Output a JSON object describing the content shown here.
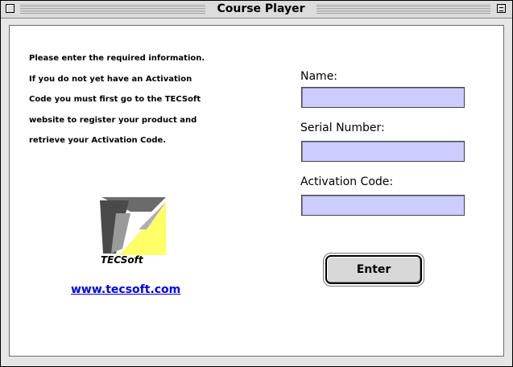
{
  "window": {
    "title": "Course Player"
  },
  "instructions": {
    "lines": [
      "Please enter the required information.",
      "If you do not yet have an Activation",
      "Code you must first go to the TECSoft",
      "website to register your product and",
      "retrieve your Activation Code."
    ]
  },
  "logo": {
    "text": "TECSoft",
    "icon": "tecsoft-logo-icon",
    "colors": {
      "dark": "#6b6b6b",
      "yellow": "#ffff66"
    }
  },
  "link": {
    "text": "www.tecsoft.com"
  },
  "form": {
    "name_label": "Name:",
    "name_value": "",
    "serial_label": "Serial Number:",
    "serial_value": "",
    "activation_label": "Activation Code:",
    "activation_value": "",
    "enter_label": "Enter"
  },
  "colors": {
    "field_background": "#ccccff",
    "link": "#0000ee"
  }
}
